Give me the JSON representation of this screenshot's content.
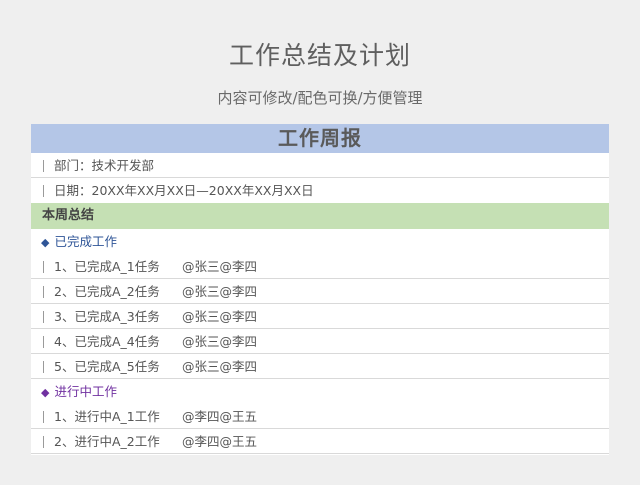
{
  "header": {
    "title": "工作总结及计划",
    "subtitle": "内容可修改/配色可换/方便管理"
  },
  "sheet": {
    "banner": "工作周报",
    "department": "部门：技术开发部",
    "date": "日期：20XX年XX月XX日—20XX年XX月XX日",
    "summary_section": "本周总结",
    "completed": {
      "heading": "已完成工作",
      "items": [
        {
          "text": "1、已完成A_1任务",
          "people": "@张三@李四"
        },
        {
          "text": "2、已完成A_2任务",
          "people": "@张三@李四"
        },
        {
          "text": "3、已完成A_3任务",
          "people": "@张三@李四"
        },
        {
          "text": "4、已完成A_4任务",
          "people": "@张三@李四"
        },
        {
          "text": "5、已完成A_5任务",
          "people": "@张三@李四"
        }
      ]
    },
    "in_progress": {
      "heading": "进行中工作",
      "items": [
        {
          "text": "1、进行中A_1工作",
          "people": "@李四@王五"
        },
        {
          "text": "2、进行中A_2工作",
          "people": "@李四@王五"
        }
      ]
    }
  },
  "colors": {
    "banner_bg": "#b4c6e7",
    "section_bg": "#c5e0b4",
    "completed_accent": "#2f5597",
    "in_progress_accent": "#7030a0"
  },
  "icons": {
    "completed_marker": "diamond-icon",
    "in_progress_marker": "diamond-icon"
  }
}
